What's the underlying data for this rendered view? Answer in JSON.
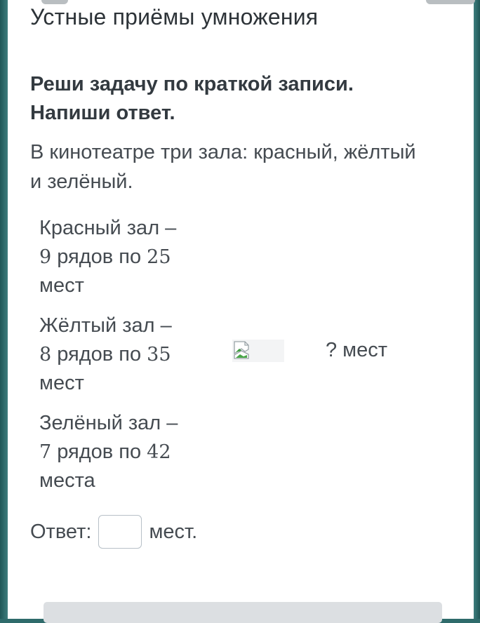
{
  "lesson": {
    "title": "Устные приёмы умножения"
  },
  "task": {
    "instruction_line1": "Реши задачу по краткой записи.",
    "instruction_line2": "Напиши ответ.",
    "problem_line1": "В кинотеатре три зала: красный, жёлтый",
    "problem_line2": "и зелёный."
  },
  "halls": [
    {
      "name": "Красный зал –",
      "rows": "9",
      "rows_text": " рядов по ",
      "seats": "25",
      "unit": "мест"
    },
    {
      "name": "Жёлтый зал –",
      "rows": "8",
      "rows_text": " рядов по ",
      "seats": "35",
      "unit": "мест"
    },
    {
      "name": "Зелёный зал –",
      "rows": "7",
      "rows_text": " рядов по ",
      "seats": "42",
      "unit": "места"
    }
  ],
  "question": "? мест",
  "answer": {
    "label": "Ответ:",
    "value": "",
    "unit": "мест."
  },
  "colors": {
    "frame": "#2f6b6b",
    "text": "#454b51",
    "input_border": "#b7c0c7"
  },
  "icons": {
    "brace_image": "broken-image-icon"
  }
}
